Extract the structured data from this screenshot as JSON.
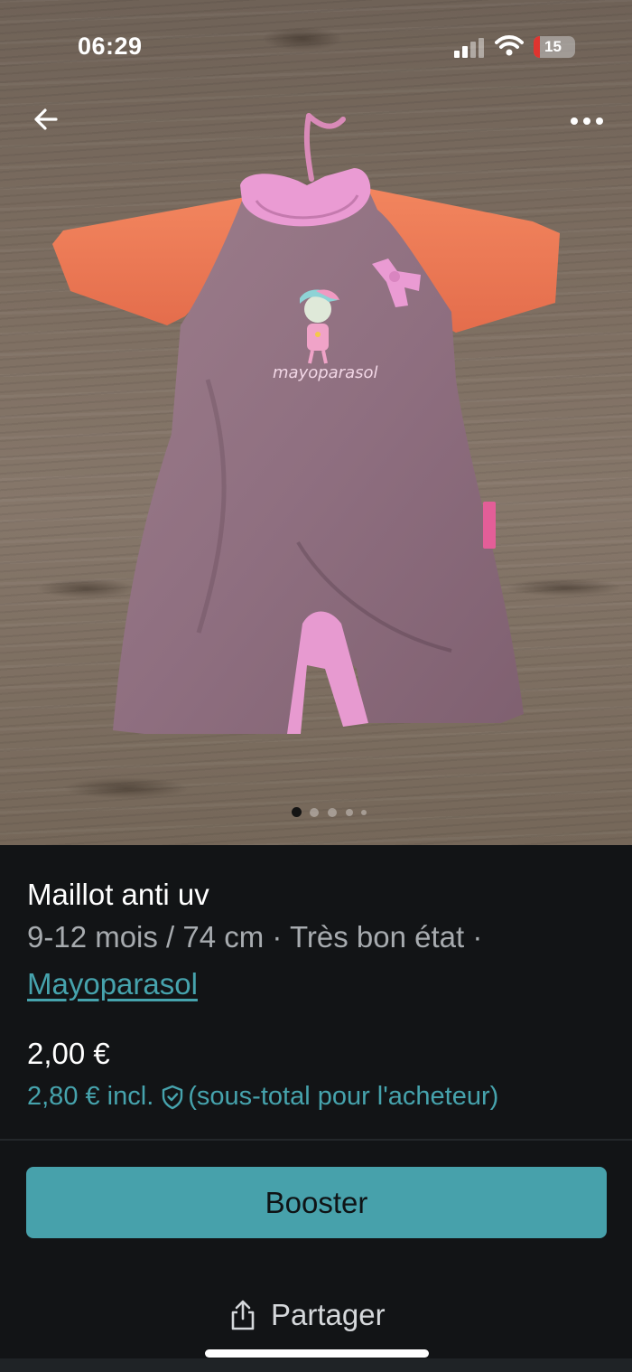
{
  "status_bar": {
    "time": "06:29",
    "battery_level": "15",
    "icons": [
      "cellular-signal-icon",
      "wifi-icon",
      "battery-icon"
    ]
  },
  "nav": {
    "back_icon": "arrow-left-icon",
    "more_icon": "more-horizontal-icon"
  },
  "photo": {
    "printed_logo": "mayoparasol",
    "carousel": {
      "total": 5,
      "active_index": 0
    }
  },
  "listing": {
    "title": "Maillot anti uv",
    "meta": "9-12 mois / 74 cm · Très bon état ·",
    "brand": "Mayoparasol",
    "price": "2,00 €",
    "price_incl": "2,80 € incl.",
    "price_incl_note": "(sous-total pour l'acheteur)"
  },
  "actions": {
    "booster_label": "Booster",
    "share_label": "Partager"
  },
  "colors": {
    "accent": "#47a1ab",
    "link": "#46a3ad",
    "background": "#121416",
    "muted_text": "#a7abaf"
  }
}
